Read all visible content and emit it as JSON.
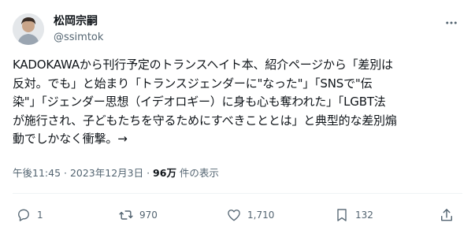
{
  "author": {
    "name": "松岡宗嗣",
    "handle": "@ssimtok"
  },
  "tweet": {
    "lines": [
      "KADOKAWAから刊行予定のトランスヘイト本、紹介ページから「差別は",
      "反対。でも」と始まり「トランスジェンダーに\"なった\"」「SNSで\"伝",
      "染\"」「ジェンダー思想（イデオロギー）に身も心も奪われた」「LGBT法",
      "が施行され、子どもたちを守るためにすべきこととは」と典型的な差別煽",
      "動でしかなく衝撃。→"
    ]
  },
  "meta": {
    "time": "午後11:45",
    "separator1": " · ",
    "date": "2023年12月3日",
    "separator2": " · ",
    "views": "96万",
    "views_suffix": " 件の表示"
  },
  "actions": {
    "replies": "1",
    "retweets": "970",
    "likes": "1,710",
    "bookmarks": "132"
  },
  "icons": {
    "more": "more-horizontal-icon",
    "reply": "reply-icon",
    "retweet": "retweet-icon",
    "like": "heart-icon",
    "bookmark": "bookmark-icon",
    "share": "share-icon"
  }
}
